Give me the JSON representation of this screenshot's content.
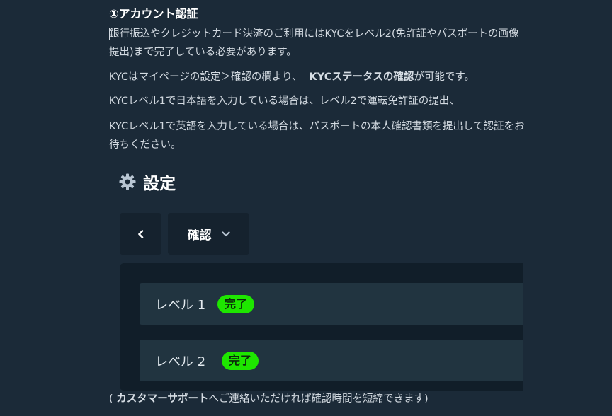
{
  "article": {
    "heading": "①アカウント認証",
    "para1": "銀行振込やクレジットカード決済のご利用にはKYCをレベル2(免許証やパスポートの画像提出)まで完了している必要があります。",
    "para2_before": "KYCはマイページの設定＞確認の欄より、",
    "para2_link": "KYCステータスの確認",
    "para2_after": "が可能です。",
    "para3": "KYCレベル1で日本語を入力している場合は、レベル2で運転免許証の提出、",
    "para4": "KYCレベル1で英語を入力している場合は、パスポートの本人確認書類を提出して認証をお待ちください。",
    "footnote_open": "( ",
    "footnote_link": "カスタマーサポート",
    "footnote_after": "へご連絡いただければ確認時間を短縮できます)"
  },
  "settings_screenshot": {
    "title": "設定",
    "title_icon": "gear-icon",
    "back_icon": "chevron-left-icon",
    "select_label": "確認",
    "select_icon": "chevron-down-icon",
    "levels": [
      {
        "label": "レベル 1",
        "status": "完了"
      },
      {
        "label": "レベル 2",
        "status": "完了"
      }
    ]
  },
  "colors": {
    "background": "#1b2a38",
    "panel": "#111e29",
    "row": "#213440",
    "badge": "#1ee600"
  }
}
